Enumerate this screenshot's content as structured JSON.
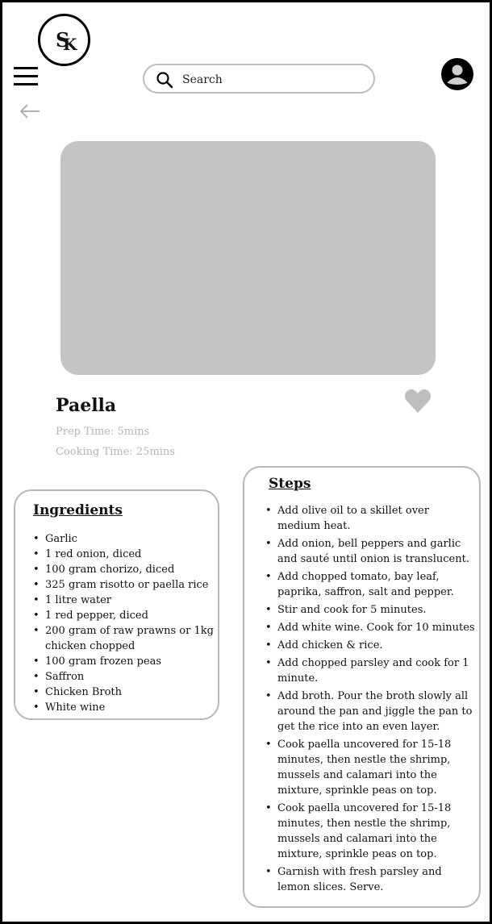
{
  "logo": {
    "letter1": "S",
    "letter2": "K"
  },
  "search": {
    "placeholder": "Search"
  },
  "icons": {
    "menu": "hamburger-menu-icon",
    "back": "back-arrow-icon",
    "search": "search-icon",
    "profile": "user-avatar-icon",
    "favorite": "heart-icon"
  },
  "colors": {
    "image_placeholder": "#c4c4c4",
    "card_border": "#b8b8b8",
    "muted_text": "#b5b5b5",
    "heart": "#bfbfbf"
  },
  "recipe": {
    "title": "Paella",
    "prep_time": "Prep Time: 5mins",
    "cooking_time": "Cooking Time: 25mins"
  },
  "ingredients": {
    "heading": "Ingredients",
    "items": [
      "Garlic",
      "1 red onion, diced",
      "100 gram chorizo, diced",
      "325 gram risotto or paella rice",
      "1 litre water",
      "1 red pepper, diced",
      "200 gram of raw prawns or 1kg chicken chopped",
      "100 gram frozen peas",
      "Saffron",
      "Chicken Broth",
      "White wine"
    ]
  },
  "steps": {
    "heading": "Steps",
    "items": [
      "Add olive oil to a skillet over medium heat.",
      "Add onion, bell peppers and garlic and sauté until onion is translucent.",
      "Add chopped tomato, bay leaf, paprika, saffron, salt and pepper.",
      "Stir and cook for 5 minutes.",
      "Add white wine. Cook for 10 minutes",
      "Add chicken & rice.",
      "Add chopped parsley and cook for 1 minute.",
      "Add broth. Pour the broth slowly all around the pan and jiggle the pan to get the rice into an even layer.",
      "Cook paella uncovered for 15-18 minutes, then nestle the shrimp, mussels and calamari into the mixture, sprinkle peas on top.",
      "Cook paella uncovered for 15-18 minutes, then nestle the shrimp, mussels and calamari into the mixture, sprinkle peas on top.",
      "Garnish with fresh parsley and lemon slices. Serve."
    ]
  }
}
